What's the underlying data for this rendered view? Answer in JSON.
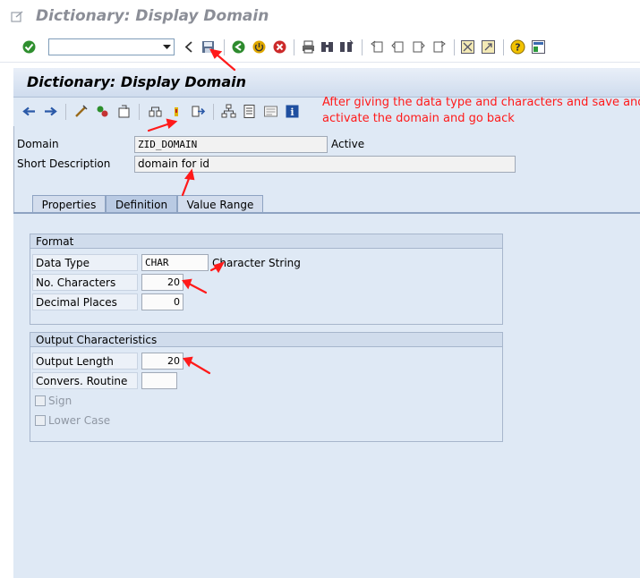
{
  "window": {
    "title": "Dictionary: Display Domain",
    "icon": "window-menu-icon"
  },
  "system_toolbar": {
    "command_field": {
      "value": "",
      "placeholder": ""
    },
    "icons": [
      "enter-checkmark-icon",
      "back-arrow-icon",
      "save-icon",
      "back-icon",
      "exit-icon",
      "cancel-icon",
      "print-icon",
      "find-icon",
      "find-next-icon",
      "first-page-icon",
      "previous-page-icon",
      "next-page-icon",
      "last-page-icon",
      "create-session-icon",
      "shortcut-icon",
      "help-icon",
      "layout-menu-icon"
    ]
  },
  "screen": {
    "title": "Dictionary: Display Domain"
  },
  "app_toolbar": {
    "icons": [
      "back-arrow-icon",
      "forward-arrow-icon",
      "display-change-icon",
      "other-object-icon",
      "check-icon",
      "activate-icon",
      "where-used-icon",
      "navigate-icon",
      "hierarchy-icon",
      "print-list-icon",
      "documentation-icon",
      "information-icon"
    ]
  },
  "annotation": {
    "line1": "After giving the data type and characters and save and",
    "line2": "activate the domain and go back",
    "color": "#ff1a1a"
  },
  "header_fields": {
    "domain_label": "Domain",
    "domain_value": "ZID_DOMAIN",
    "domain_status": "Active",
    "short_desc_label": "Short Description",
    "short_desc_value": "domain for id"
  },
  "tabs": [
    {
      "label": "Properties",
      "active": false
    },
    {
      "label": "Definition",
      "active": true
    },
    {
      "label": "Value Range",
      "active": false
    }
  ],
  "format_group": {
    "title": "Format",
    "data_type_label": "Data Type",
    "data_type_value": "CHAR",
    "data_type_text": "Character String",
    "no_chars_label": "No. Characters",
    "no_chars_value": "20",
    "decimal_label": "Decimal Places",
    "decimal_value": "0"
  },
  "output_group": {
    "title": "Output Characteristics",
    "output_length_label": "Output Length",
    "output_length_value": "20",
    "convers_label": "Convers. Routine",
    "convers_value": "",
    "sign_label": "Sign",
    "lower_case_label": "Lower Case"
  }
}
